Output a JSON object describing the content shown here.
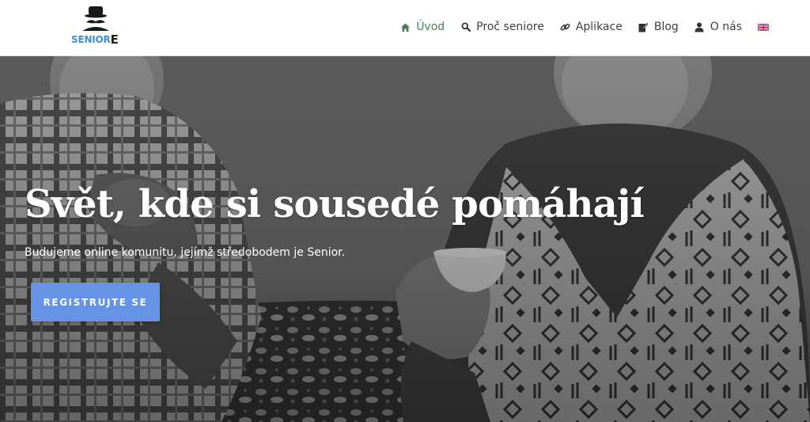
{
  "brand": {
    "logo_text": "SENIOR",
    "logo_text_e": "E",
    "logo_icon": "senior-hat-mustache-icon",
    "accent_color": "#3d8ed8"
  },
  "nav": {
    "items": [
      {
        "label": "Úvod",
        "icon": "home-icon",
        "active": true
      },
      {
        "label": "Proč seniore",
        "icon": "search-icon",
        "active": false
      },
      {
        "label": "Aplikace",
        "icon": "link-icon",
        "active": false
      },
      {
        "label": "Blog",
        "icon": "edit-icon",
        "active": false
      },
      {
        "label": "O nás",
        "icon": "user-icon",
        "active": false
      }
    ],
    "language_icon": "uk-flag-icon",
    "active_color": "#4a7d5c"
  },
  "hero": {
    "title": "Svět, kde si sousedé pomáhají",
    "subtitle": "Budujeme online komunitu, jejímž středobodem je Senior.",
    "cta_label": "REGISTRUJTE SE",
    "cta_color": "#6593e6",
    "image": "grayscale photo of two elderly men holding cups"
  }
}
